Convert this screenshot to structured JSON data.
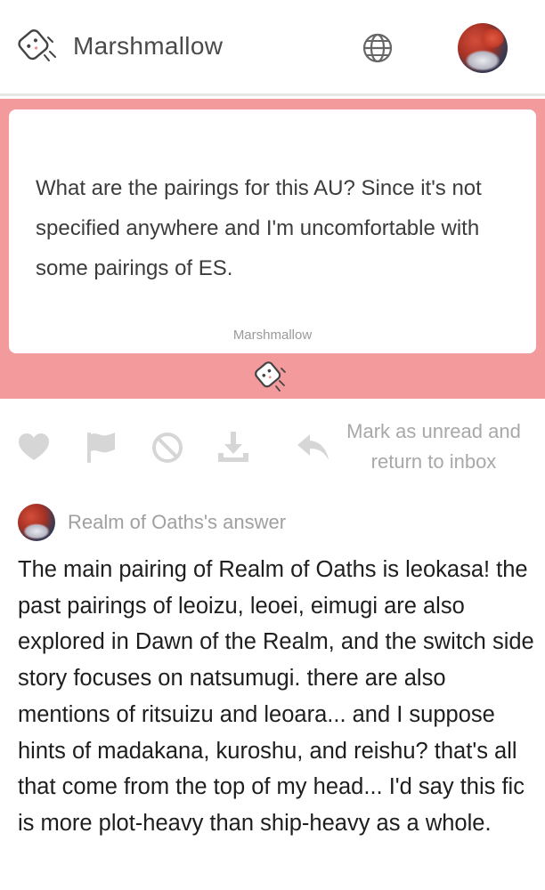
{
  "header": {
    "app_name": "Marshmallow",
    "logo_icon": "marshmallow-mascot-icon",
    "globe_icon": "globe-icon",
    "avatar": "user-avatar"
  },
  "question": {
    "text": "What are the pairings for this AU? Since it's not specified anywhere and I'm uncomfortable with some pairings of ES.",
    "source": "Marshmallow",
    "band_color": "#f39a9c"
  },
  "actions": {
    "icons": [
      "heart-icon",
      "flag-icon",
      "block-icon",
      "download-icon",
      "reply-icon"
    ],
    "mark_unread_label": "Mark as unread and return to inbox",
    "icon_color": "#d6d6d6"
  },
  "answer": {
    "label": "Realm of Oaths's answer",
    "text": "The main pairing of Realm of Oaths is leokasa! the past pairings of leoizu, leoei, eimugi are also explored in Dawn of the Realm, and the switch side story focuses on natsumugi. there are also mentions of ritsuizu and leoara... and I suppose hints of madakana, kuroshu, and reishu? that's all that come from the top of my head... I'd say this fic is more plot-heavy than ship-heavy as a whole."
  }
}
